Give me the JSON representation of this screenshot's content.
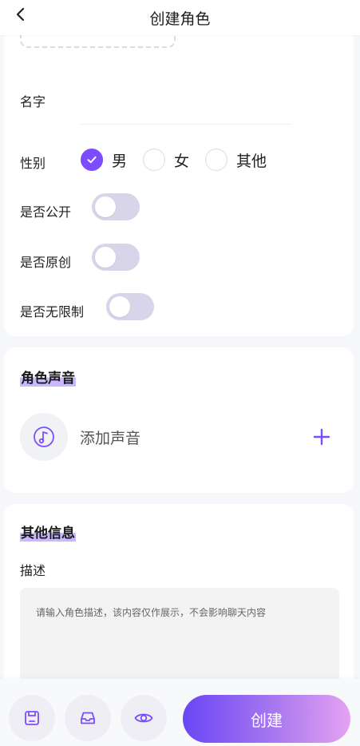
{
  "header": {
    "title": "创建角色",
    "back_icon": "chevron-left-icon"
  },
  "basic": {
    "name_label": "名字",
    "gender_label": "性别",
    "gender_options": [
      {
        "label": "男",
        "checked": true
      },
      {
        "label": "女",
        "checked": false
      },
      {
        "label": "其他",
        "checked": false
      }
    ],
    "public_label": "是否公开",
    "public_on": false,
    "original_label": "是否原创",
    "original_on": false,
    "unlimited_label": "是否无限制",
    "unlimited_on": false
  },
  "voice": {
    "title": "角色声音",
    "add_text": "添加声音",
    "icon": "music-note-icon",
    "add_icon": "plus-icon"
  },
  "other": {
    "title": "其他信息",
    "desc_label": "描述",
    "desc_placeholder": "请输入角色描述，该内容仅作展示，不会影响聊天内容"
  },
  "bottom": {
    "create_label": "创建",
    "icons": [
      "save-icon",
      "inbox-icon",
      "eye-icon"
    ]
  },
  "colors": {
    "accent": "#7c4dff",
    "toggle_off": "#d8d5ea",
    "highlight": "#c9b8ff"
  }
}
